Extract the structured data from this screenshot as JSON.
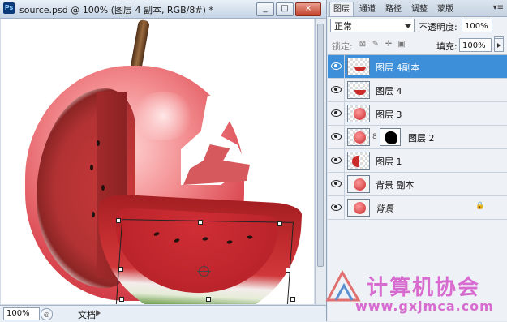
{
  "document": {
    "title": "source.psd @ 100% (图层 4 副本, RGB/8#) *",
    "ps_badge": "Ps",
    "buttons": {
      "minimize": "_",
      "maximize": "□",
      "close": "×"
    },
    "status": {
      "zoom": "100%",
      "doc_label": "文档"
    }
  },
  "panel": {
    "tabs": [
      "图层",
      "通道",
      "路径",
      "调整",
      "蒙版"
    ],
    "active_tab": "图层",
    "menu_glyph": "▾≡",
    "blend_mode": "正常",
    "opacity_label": "不透明度:",
    "opacity_value": "100%",
    "lock_label": "锁定:",
    "fill_label": "填充:",
    "fill_value": "100%",
    "layers": [
      {
        "name": "图层 4副本",
        "selected": true,
        "thumb": "melon"
      },
      {
        "name": "图层 4",
        "selected": false,
        "thumb": "melon"
      },
      {
        "name": "图层 3",
        "selected": false,
        "thumb": "apple"
      },
      {
        "name": "图层 2",
        "selected": false,
        "thumb": "apple",
        "mask": true
      },
      {
        "name": "图层 1",
        "selected": false,
        "thumb": "half"
      },
      {
        "name": "背景 副本",
        "selected": false,
        "thumb": "apple"
      },
      {
        "name": "背景",
        "selected": false,
        "thumb": "apple",
        "italic": true,
        "locked": true
      }
    ]
  },
  "watermark": {
    "text": "计算机协会",
    "url": "www.gxjmca.com"
  }
}
